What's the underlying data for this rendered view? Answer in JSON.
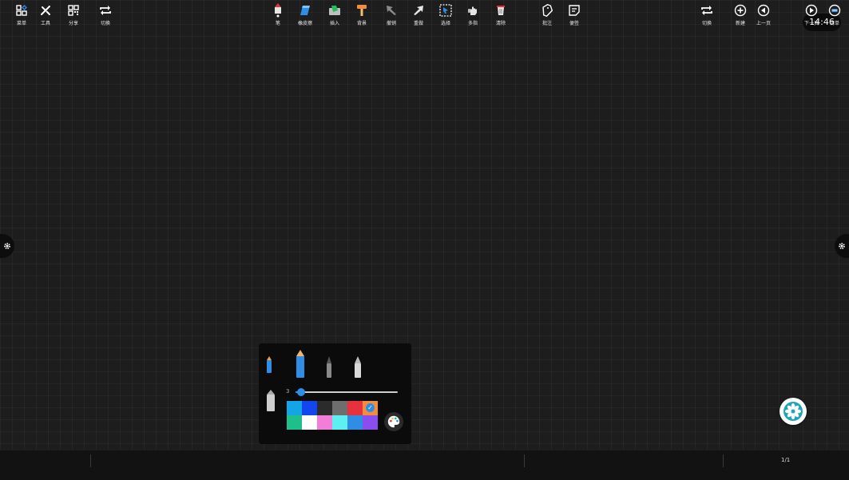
{
  "clock": "14:46",
  "pen_panel": {
    "size_value": "3",
    "size_level": 0.03,
    "pens": [
      "thin-pen",
      "highlighter-pen",
      "brush-pen",
      "marker-pen",
      "chalk-pen"
    ],
    "colors_row1": [
      "#14a5e6",
      "#1446f0",
      "#2b2b2b",
      "#6e6e6e",
      "#e8313e",
      "#f58b3c"
    ],
    "colors_row2": [
      "#1fbf8c",
      "#ffffff",
      "#f27ed8",
      "#5ef0f0",
      "#2f8de4",
      "#8a4ef0"
    ],
    "selected_color": "#f58b3c",
    "check_glyph": "✓",
    "palette_icon": "color-palette-icon"
  },
  "toolbar": {
    "left": [
      {
        "label": "菜单",
        "icon": "menu-grid-icon"
      },
      {
        "label": "工具",
        "icon": "tools-icon"
      },
      {
        "label": "分享",
        "icon": "qr-share-icon"
      },
      {
        "label": "切换",
        "icon": "switch-icon"
      }
    ],
    "center": [
      {
        "label": "笔",
        "icon": "pen-icon"
      },
      {
        "label": "橡皮擦",
        "icon": "eraser-icon"
      },
      {
        "label": "插入",
        "icon": "insert-icon"
      },
      {
        "label": "背景",
        "icon": "background-brush-icon"
      },
      {
        "label": "撤销",
        "icon": "undo-icon"
      },
      {
        "label": "重做",
        "icon": "redo-icon"
      },
      {
        "label": "选择",
        "icon": "select-icon"
      },
      {
        "label": "多指",
        "icon": "multi-touch-icon"
      },
      {
        "label": "清除",
        "icon": "clear-trash-icon"
      },
      {
        "label": "批注",
        "icon": "annotate-icon"
      },
      {
        "label": "便签",
        "icon": "sticky-note-icon"
      }
    ],
    "right": [
      {
        "label": "切换",
        "icon": "switch-icon"
      },
      {
        "label": "新建",
        "icon": "add-page-icon"
      },
      {
        "label": "上一页",
        "icon": "prev-page-icon"
      },
      {
        "label": "下一页",
        "icon": "next-page-icon"
      },
      {
        "label": "清单",
        "icon": "page-list-icon"
      }
    ],
    "page_indicator": "1/1"
  }
}
